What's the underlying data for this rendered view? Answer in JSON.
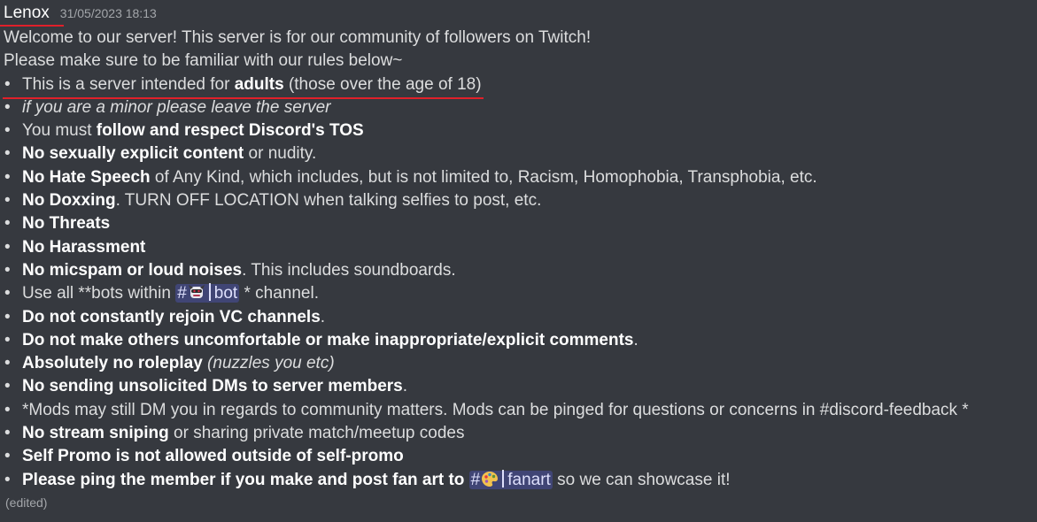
{
  "author": {
    "name": "Lenox",
    "timestamp": "31/05/2023 18:13"
  },
  "intro": [
    "Welcome to our server! This server is for our community of followers on Twitch!",
    "Please make sure to be familiar with our rules below~"
  ],
  "rules": {
    "r1": {
      "pre": "This is a server intended for ",
      "bold": "adults",
      "post": " (those over the age of 18)"
    },
    "r2": {
      "italic": "if you are a minor please leave the server"
    },
    "r3": {
      "pre": "You must ",
      "bold": "follow and respect Discord's TOS"
    },
    "r4": {
      "bold": "No sexually explicit content",
      "post": " or nudity."
    },
    "r5": {
      "bold": "No Hate Speech",
      "post": " of Any Kind, which includes, but is not limited to, Racism, Homophobia, Transphobia, etc."
    },
    "r6": {
      "bold": "No Doxxing",
      "post": ". TURN OFF LOCATION when talking selfies to post, etc."
    },
    "r7": {
      "bold": "No Threats"
    },
    "r8": {
      "bold": "No Harassment"
    },
    "r9": {
      "bold": "No micspam or loud noises",
      "post": ". This includes soundboards."
    },
    "r10": {
      "pre": "Use all **bots within ",
      "post": " * channel."
    },
    "r11": {
      "bold": "Do not constantly rejoin VC channels",
      "post": "."
    },
    "r12": {
      "bold": "Do not make others uncomfortable or make inappropriate/explicit comments",
      "post": "."
    },
    "r13": {
      "bold": "Absolutely no roleplay",
      "italic": "(nuzzles you etc)"
    },
    "r14": {
      "bold": "No sending unsolicited DMs to server members",
      "post": "."
    },
    "r15": {
      "text": "*Mods may still DM you in regards to community matters. Mods can be pinged for questions or concerns in #discord-feedback *"
    },
    "r16": {
      "bold": "No stream sniping",
      "post": " or sharing private match/meetup codes"
    },
    "r17": {
      "bold": "Self Promo is not allowed outside of self-promo"
    },
    "r18": {
      "bold": "Please ping the member if you make and post fan art to",
      "post": " so we can showcase it!"
    }
  },
  "channels": {
    "bot": {
      "hash": "#",
      "name": "bot",
      "icon": "robot-emoji-icon"
    },
    "fanart": {
      "hash": "#",
      "name": "fanart",
      "icon": "palette-emoji-icon"
    }
  },
  "edited_label": "(edited)",
  "colors": {
    "background": "#36393f",
    "text": "#dcddde",
    "mention_bg": "#414675",
    "annotation_red": "#e0202a"
  }
}
